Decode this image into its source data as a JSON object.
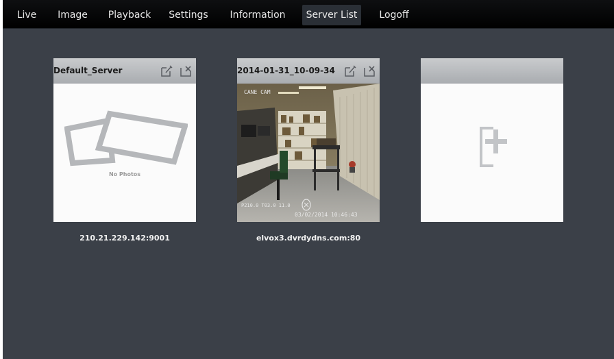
{
  "menu": {
    "items": [
      {
        "label": "Live"
      },
      {
        "label": "Image"
      },
      {
        "label": "Playback"
      },
      {
        "label": "Settings"
      },
      {
        "label": "Information"
      },
      {
        "label": "Server List",
        "active": true
      },
      {
        "label": "Logoff"
      }
    ]
  },
  "servers": [
    {
      "title": "Default_Server",
      "address": "210.21.229.142:9001",
      "placeholder_text": "No Photos",
      "icons": [
        "edit-icon",
        "delete-icon"
      ]
    },
    {
      "title": "2014-01-31_10-09-34",
      "address": "elvox3.dvrdydns.com:80",
      "camera_name": "CANE CAM",
      "camera_stats": "P210.0 T03.0 11.0",
      "camera_timestamp": "03/02/2014 10:46:43",
      "icons": [
        "edit-icon",
        "delete-icon"
      ]
    }
  ],
  "add_server": {
    "icon": "add-server-icon"
  },
  "colors": {
    "background": "#3b4048",
    "topbar": "#000000",
    "active_tab": "#2a2f36",
    "card_header": "#b8babd"
  }
}
